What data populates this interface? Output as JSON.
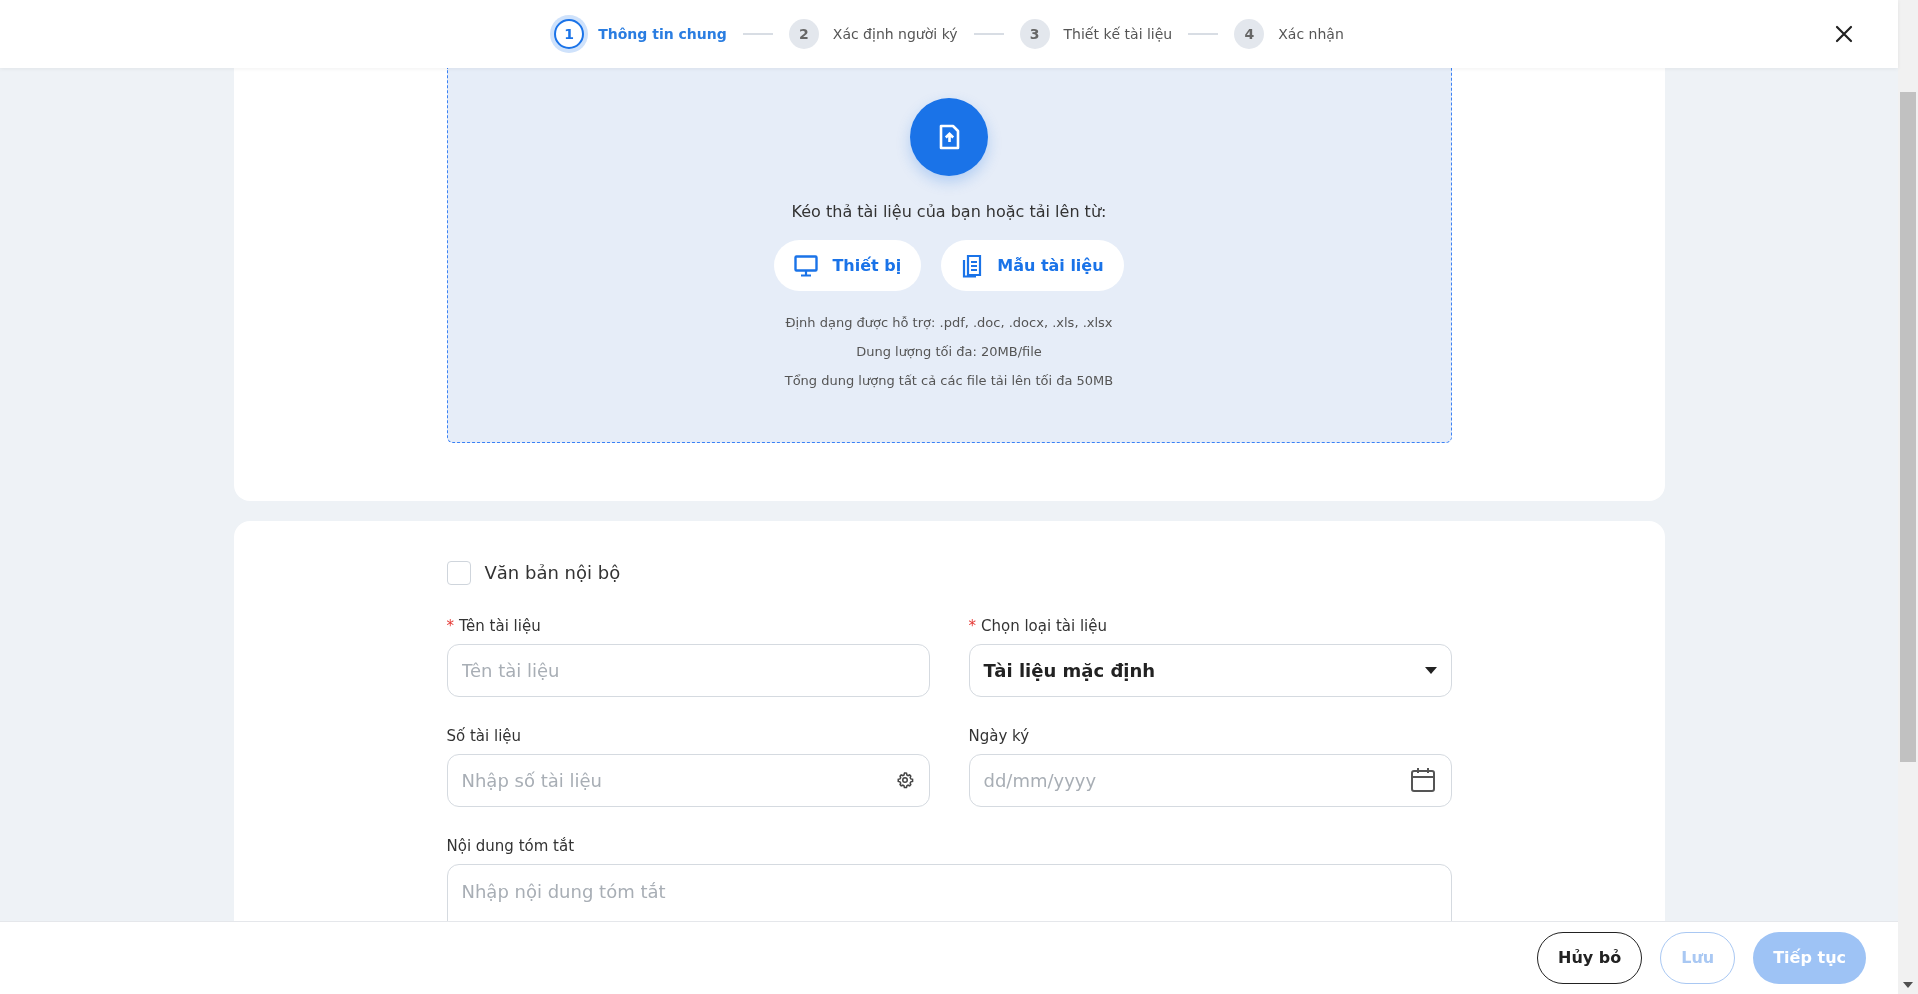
{
  "stepper": [
    {
      "number": "1",
      "label": "Thông tin chung",
      "selected": true
    },
    {
      "number": "2",
      "label": "Xác định người ký",
      "selected": false
    },
    {
      "number": "3",
      "label": "Thiết kế tài liệu",
      "selected": false
    },
    {
      "number": "4",
      "label": "Xác nhận",
      "selected": false
    }
  ],
  "upload": {
    "prompt": "Kéo thả tài liệu của bạn hoặc tải lên từ:",
    "sources": [
      {
        "kind": "device",
        "label": "Thiết bị"
      },
      {
        "kind": "template",
        "label": "Mẫu tài liệu"
      }
    ],
    "notes": [
      "Định dạng được hỗ trợ: .pdf, .doc, .docx, .xls, .xlsx",
      "Dung lượng tối đa: 20MB/file",
      "Tổng dung lượng tất cả các file tải lên tối đa 50MB"
    ]
  },
  "internal_checkbox": {
    "label": "Văn bản nội bộ",
    "checked": false
  },
  "fields": [
    {
      "kind": "text",
      "label": "Tên tài liệu",
      "required_mark": "*",
      "placeholder": "Tên tài liệu"
    },
    {
      "kind": "select",
      "label": "Chọn loại tài liệu",
      "required_mark": "*",
      "value": "Tài liệu mặc định"
    },
    {
      "kind": "number",
      "label": "Số tài liệu",
      "placeholder": "Nhập số tài liệu"
    },
    {
      "kind": "date",
      "label": "Ngày ký",
      "placeholder": "dd/mm/yyyy"
    },
    {
      "kind": "textarea",
      "label": "Nội dung tóm tắt",
      "placeholder": "Nhập nội dung tóm tắt"
    }
  ],
  "footer_buttons": [
    {
      "kind": "cancel",
      "label": "Hủy bỏ",
      "disabled": false
    },
    {
      "kind": "save",
      "label": "Lưu",
      "disabled": true
    },
    {
      "kind": "next",
      "label": "Tiếp tục",
      "disabled": true
    }
  ]
}
